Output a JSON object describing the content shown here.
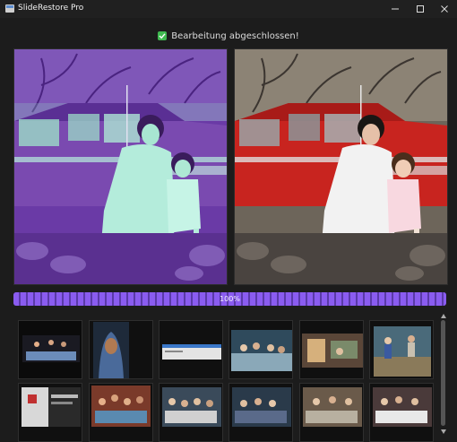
{
  "window": {
    "title": "SlideRestore Pro"
  },
  "status": {
    "message": "Bearbeitung abgeschlossen!"
  },
  "progress": {
    "value": 100,
    "label": "100%"
  },
  "colors": {
    "accent": "#8a5cf0",
    "success": "#3fb950"
  },
  "images": {
    "before_label": "before-photo",
    "after_label": "after-photo"
  }
}
